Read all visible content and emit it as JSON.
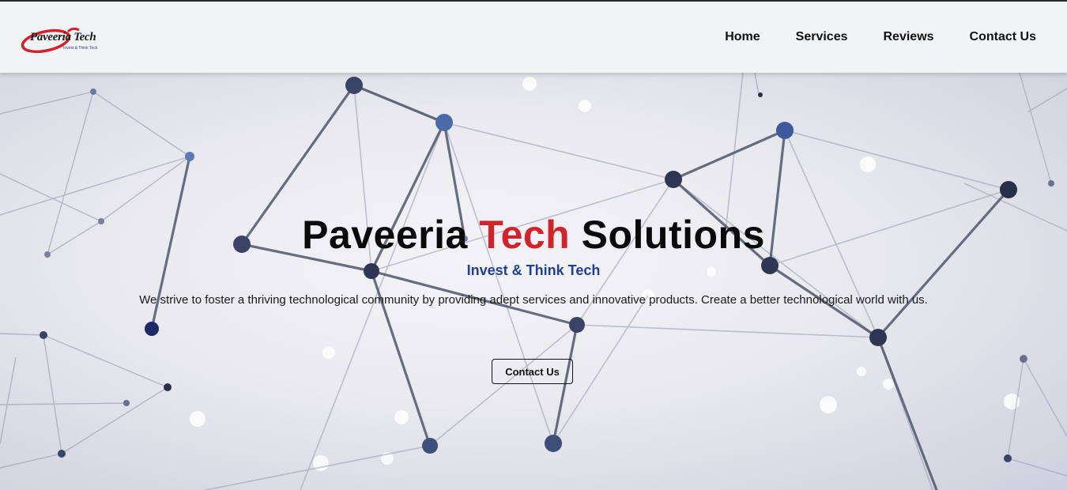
{
  "brand": {
    "logo_text": "Paveeria Tech",
    "logo_tagline": "Invest & Think Tech",
    "accent_color": "#d4222a",
    "subtitle_color": "#1e3f9a"
  },
  "nav": {
    "items": [
      {
        "label": "Home"
      },
      {
        "label": "Services"
      },
      {
        "label": "Reviews"
      },
      {
        "label": "Contact Us"
      }
    ]
  },
  "hero": {
    "title_part1": "Paveeria ",
    "title_accent": "Tech",
    "title_part2": " Solutions",
    "subtitle": "Invest & Think Tech",
    "description": "We strive to foster a thriving technological community by providing adept services and innovative products. Create a better technological world with us.",
    "cta_label": "Contact Us",
    "background": "network-nodes-image"
  }
}
